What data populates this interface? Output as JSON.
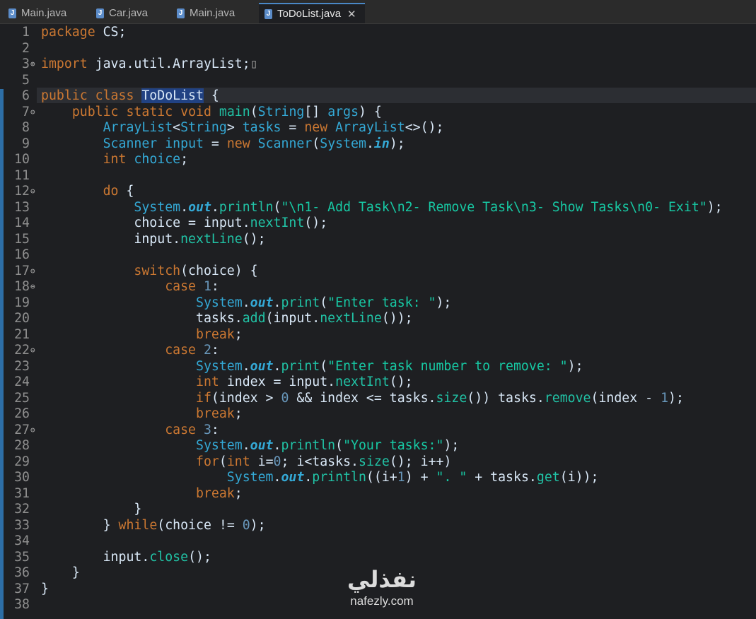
{
  "tabs": [
    {
      "label": "Main.java",
      "icon": "java-file-icon",
      "active": false
    },
    {
      "label": "Car.java",
      "icon": "java-file-icon",
      "active": false
    },
    {
      "label": "Main.java",
      "icon": "java-file-icon",
      "active": false
    },
    {
      "label": "ToDoList.java",
      "icon": "java-file-icon",
      "active": true
    }
  ],
  "tab_icon_glyph": "J",
  "close_glyph": "✕",
  "editor": {
    "line_numbers": [
      "1",
      "2",
      "3",
      "5",
      "6",
      "7",
      "8",
      "9",
      "10",
      "11",
      "12",
      "13",
      "14",
      "15",
      "16",
      "17",
      "18",
      "19",
      "20",
      "21",
      "22",
      "23",
      "24",
      "25",
      "26",
      "27",
      "28",
      "29",
      "30",
      "31",
      "32",
      "33",
      "34",
      "35",
      "36",
      "37",
      "38"
    ],
    "folded_marker": "⊕",
    "fold_marker": "⊖",
    "lines": {
      "l1": [
        "package",
        " CS;"
      ],
      "l3": [
        "import",
        " java.util.ArrayList;",
        "▯"
      ],
      "l6": [
        "public",
        " ",
        "class",
        " ",
        "ToDoList",
        " {"
      ],
      "l7": [
        "    ",
        "public",
        " ",
        "static",
        " ",
        "void",
        " ",
        "main",
        "(",
        "String",
        "[] ",
        "args",
        ") {"
      ],
      "l8": [
        "        ",
        "ArrayList",
        "<",
        "String",
        "> ",
        "tasks",
        " = ",
        "new",
        " ",
        "ArrayList",
        "<>();"
      ],
      "l9": [
        "        ",
        "Scanner",
        " ",
        "input",
        " = ",
        "new",
        " ",
        "Scanner",
        "(",
        "System",
        ".",
        "in",
        ");"
      ],
      "l10": [
        "        ",
        "int",
        " ",
        "choice",
        ";"
      ],
      "l12": [
        "        ",
        "do",
        " {"
      ],
      "l13": [
        "            ",
        "System",
        ".",
        "out",
        ".",
        "println",
        "(",
        "\"\\n1- Add Task\\n2- Remove Task\\n3- Show Tasks\\n0- Exit\"",
        ");"
      ],
      "l14": [
        "            ",
        "choice = input.",
        "nextInt",
        "();"
      ],
      "l15": [
        "            ",
        "input.",
        "nextLine",
        "();"
      ],
      "l17": [
        "            ",
        "switch",
        "(choice) {"
      ],
      "l18": [
        "                ",
        "case",
        " ",
        "1",
        ":"
      ],
      "l19": [
        "                    ",
        "System",
        ".",
        "out",
        ".",
        "print",
        "(",
        "\"Enter task: \"",
        ");"
      ],
      "l20": [
        "                    ",
        "tasks.",
        "add",
        "(input.",
        "nextLine",
        "());"
      ],
      "l21": [
        "                    ",
        "break",
        ";"
      ],
      "l22": [
        "                ",
        "case",
        " ",
        "2",
        ":"
      ],
      "l23": [
        "                    ",
        "System",
        ".",
        "out",
        ".",
        "print",
        "(",
        "\"Enter task number to remove: \"",
        ");"
      ],
      "l24": [
        "                    ",
        "int",
        " ",
        "index",
        " = input.",
        "nextInt",
        "();"
      ],
      "l25": [
        "                    ",
        "if",
        "(",
        "index",
        " > ",
        "0",
        " && ",
        "index",
        " <= tasks.",
        "size",
        "()) tasks.",
        "remove",
        "(",
        "index",
        " - ",
        "1",
        ");"
      ],
      "l26": [
        "                    ",
        "break",
        ";"
      ],
      "l27": [
        "                ",
        "case",
        " ",
        "3",
        ":"
      ],
      "l28": [
        "                    ",
        "System",
        ".",
        "out",
        ".",
        "println",
        "(",
        "\"Your tasks:\"",
        ");"
      ],
      "l29": [
        "                    ",
        "for",
        "(",
        "int",
        " ",
        "i",
        "=",
        "0",
        "; ",
        "i",
        "<tasks.",
        "size",
        "(); ",
        "i",
        "++)"
      ],
      "l30": [
        "                        ",
        "System",
        ".",
        "out",
        ".",
        "println",
        "((",
        "i",
        "+",
        "1",
        ") + ",
        "\". \"",
        " + tasks.",
        "get",
        "(",
        "i",
        "));"
      ],
      "l31": [
        "                    ",
        "break",
        ";"
      ],
      "l32": [
        "            ",
        "}"
      ],
      "l33": [
        "        ",
        "} ",
        "while",
        "(choice != ",
        "0",
        ");"
      ],
      "l35": [
        "        ",
        "input.",
        "close",
        "();"
      ],
      "l36": [
        "    ",
        "}"
      ],
      "l37": [
        "}"
      ]
    }
  },
  "watermark": {
    "arabic": "نفذلي",
    "domain": "nafezly.com"
  },
  "colors": {
    "background": "#1e1f22",
    "keyword": "#cc7832",
    "type": "#34a9d6",
    "method": "#21c3a6",
    "string": "#17c9a4",
    "number": "#6897bb",
    "text": "#d9e8f7",
    "selection": "#214283",
    "active_tab_border": "#4a88c7"
  }
}
